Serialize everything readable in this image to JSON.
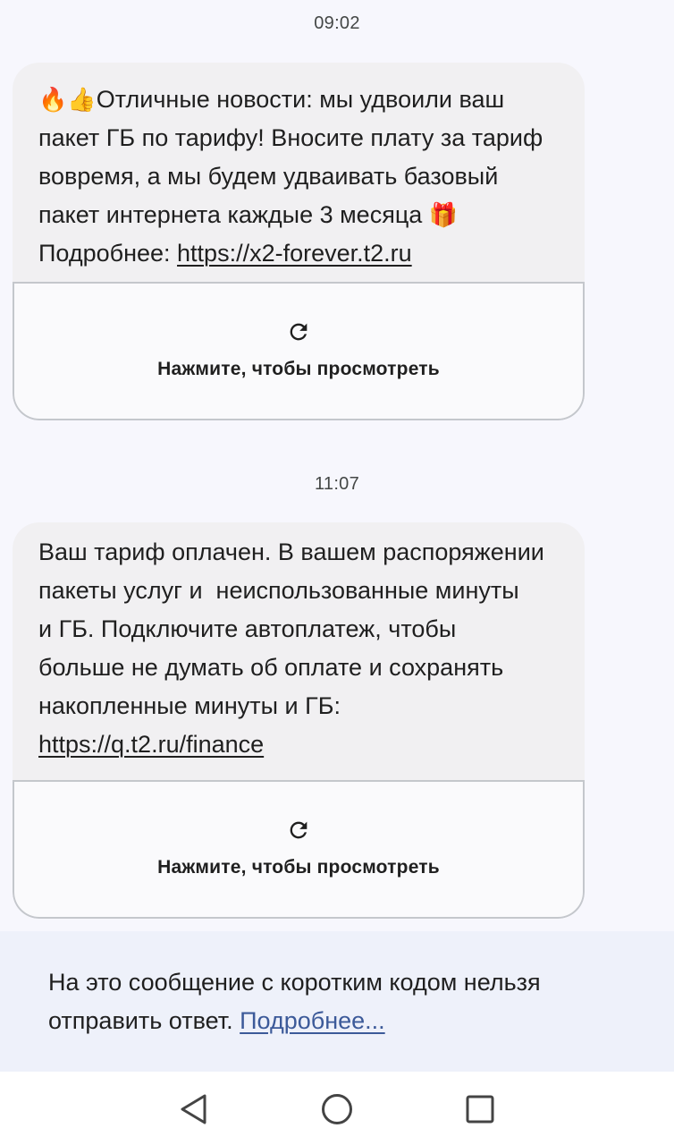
{
  "messages": [
    {
      "timestamp": "09:02",
      "lines": [
        {
          "emoji": "🔥👍",
          "text": "Отличные новости: мы удвоили ваш"
        },
        {
          "text": "пакет ГБ по тарифу! Вносите плату за тариф"
        },
        {
          "text": "вовремя, а мы будем удваивать базовый"
        },
        {
          "text": "пакет интернета каждые 3 месяца",
          "emoji_after": "🎁"
        },
        {
          "prefix": "Подробнее: ",
          "link": "https://x2-forever.t2.ru"
        }
      ],
      "preview_label": "Нажмите, чтобы просмотреть"
    },
    {
      "timestamp": "11:07",
      "lines": [
        {
          "text": "Ваш тариф оплачен. В вашем распоряжении"
        },
        {
          "text": "пакеты услуг и  неиспользованные минуты"
        },
        {
          "text": "и ГБ. Подключите автоплатеж, чтобы"
        },
        {
          "text": "больше не думать об оплате и сохранять"
        },
        {
          "text": "накопленные минуты и ГБ:"
        },
        {
          "link": "https://q.t2.ru/finance"
        }
      ],
      "preview_label": "Нажмите, чтобы просмотреть"
    }
  ],
  "notice": {
    "text_line1": "На это сообщение с коротким кодом нельзя",
    "text_line2": "отправить ответ. ",
    "link": "Подробнее..."
  },
  "navbar": {
    "back_icon": "back-triangle-icon",
    "home_icon": "home-circle-icon",
    "recents_icon": "recents-square-icon"
  },
  "colors": {
    "background": "#f7f7fd",
    "bubble": "#f1f0f2",
    "notice_bg": "#eef1fa",
    "link_blue": "#3c5a99"
  }
}
